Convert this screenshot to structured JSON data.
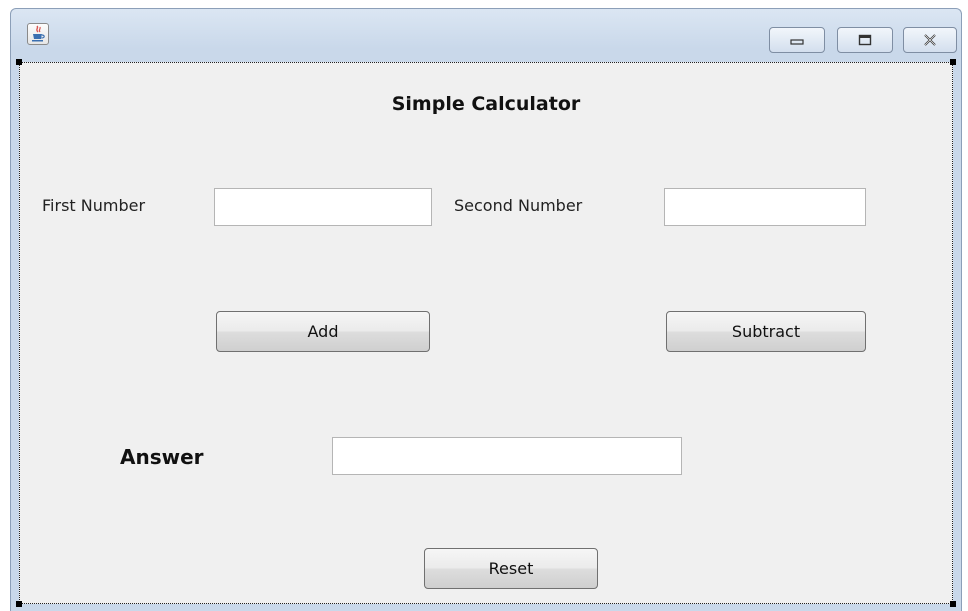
{
  "window": {
    "controls": {
      "minimize_icon": "minimize-icon",
      "maximize_icon": "maximize-icon",
      "close_icon": "close-icon"
    },
    "app_icon": "java-coffee-cup-icon"
  },
  "form": {
    "title": "Simple Calculator",
    "first_number_label": "First Number",
    "first_number_value": "",
    "second_number_label": "Second Number",
    "second_number_value": "",
    "add_label": "Add",
    "subtract_label": "Subtract",
    "answer_label": "Answer",
    "answer_value": "",
    "reset_label": "Reset"
  },
  "colors": {
    "titlebar": "#c9d8ea",
    "panel": "#f0f0f0"
  }
}
